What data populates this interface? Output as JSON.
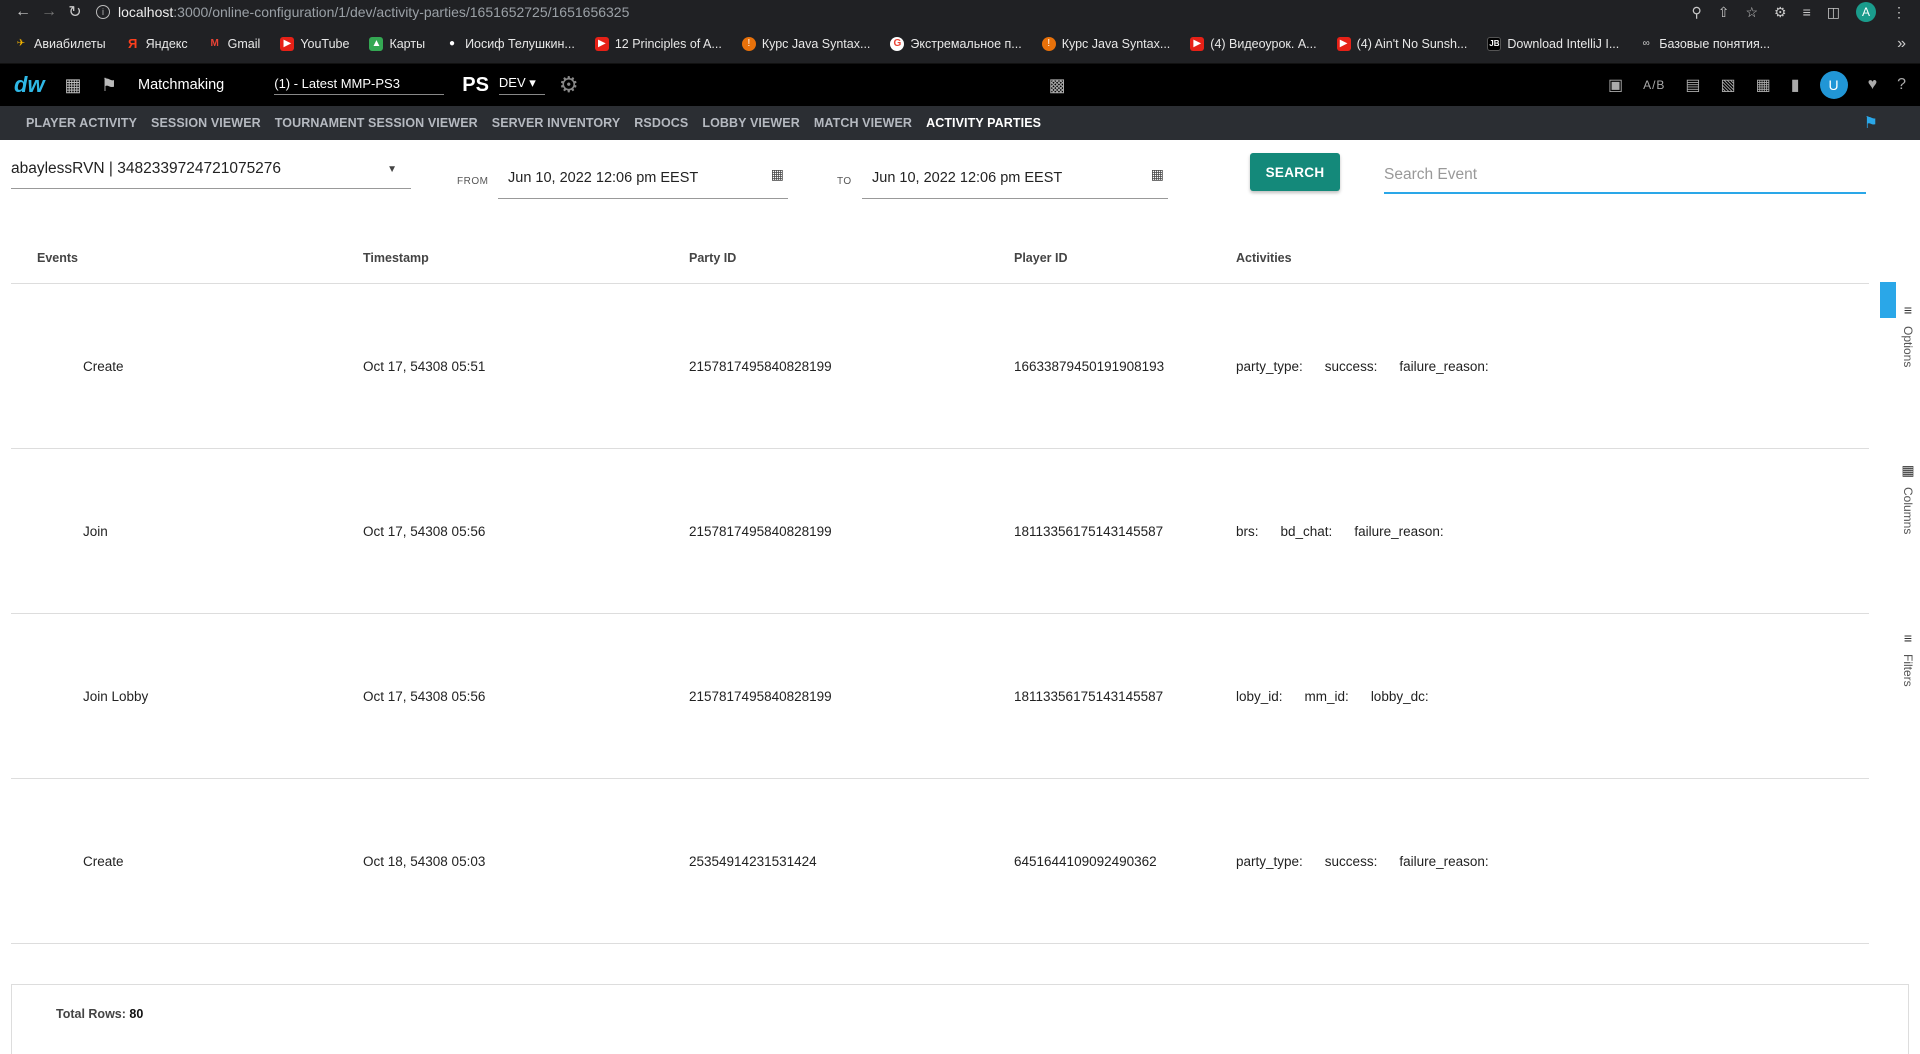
{
  "browser": {
    "url_host": "localhost",
    "url_path": ":3000/online-configuration/1/dev/activity-parties/1651652725/1651656325",
    "profile_initial": "A"
  },
  "bookmarks": [
    {
      "label": "Авиабилеты",
      "icon": "plane-icon"
    },
    {
      "label": "Яндекс",
      "icon": "yandex-icon"
    },
    {
      "label": "Gmail",
      "icon": "gmail-icon"
    },
    {
      "label": "YouTube",
      "icon": "youtube-icon"
    },
    {
      "label": "Карты",
      "icon": "maps-icon"
    },
    {
      "label": "Иосиф Телушкин...",
      "icon": "apple-icon"
    },
    {
      "label": "12 Principles of A...",
      "icon": "youtube-icon"
    },
    {
      "label": "Курс Java Syntax...",
      "icon": "javarush-icon"
    },
    {
      "label": "Экстремальное п...",
      "icon": "google-icon"
    },
    {
      "label": "Курс Java Syntax...",
      "icon": "javarush-icon"
    },
    {
      "label": "(4) Видеоурок. A...",
      "icon": "youtube-icon"
    },
    {
      "label": "(4) Ain't No Sunsh...",
      "icon": "youtube-icon"
    },
    {
      "label": "Download IntelliJ I...",
      "icon": "jetbrains-icon"
    },
    {
      "label": "Базовые понятия...",
      "icon": "link-icon"
    }
  ],
  "header": {
    "logo": "dw",
    "app_name": "Matchmaking",
    "environment": "(1) - Latest MMP-PS3",
    "platform_logo": "PS",
    "stage": "DEV",
    "ab_label": "A/B",
    "user_initial": "U"
  },
  "tabs": [
    {
      "label": "PLAYER ACTIVITY",
      "active": false
    },
    {
      "label": "SESSION VIEWER",
      "active": false
    },
    {
      "label": "TOURNAMENT SESSION VIEWER",
      "active": false
    },
    {
      "label": "SERVER INVENTORY",
      "active": false
    },
    {
      "label": "RSDOCS",
      "active": false
    },
    {
      "label": "LOBBY VIEWER",
      "active": false
    },
    {
      "label": "MATCH VIEWER",
      "active": false
    },
    {
      "label": "ACTIVITY PARTIES",
      "active": true
    }
  ],
  "filters": {
    "player": "abaylessRVN | 3482339724721075276",
    "from_label": "FROM",
    "from_value": "Jun 10, 2022 12:06 pm EEST",
    "to_label": "TO",
    "to_value": "Jun 10, 2022 12:06 pm EEST",
    "search_button": "SEARCH",
    "search_placeholder": "Search Event"
  },
  "table": {
    "columns": [
      "Events",
      "Timestamp",
      "Party ID",
      "Player ID",
      "Activities"
    ],
    "rows": [
      {
        "event": "Create",
        "timestamp": "Oct 17, 54308 05:51",
        "party_id": "2157817495840828199",
        "player_id": "16633879450191908193",
        "activities": [
          "party_type:",
          "success:",
          "failure_reason:"
        ]
      },
      {
        "event": "Join",
        "timestamp": "Oct 17, 54308 05:56",
        "party_id": "2157817495840828199",
        "player_id": "18113356175143145587",
        "activities": [
          "brs:",
          "bd_chat:",
          "failure_reason:"
        ]
      },
      {
        "event": "Join Lobby",
        "timestamp": "Oct 17, 54308 05:56",
        "party_id": "2157817495840828199",
        "player_id": "18113356175143145587",
        "activities": [
          "loby_id:",
          "mm_id:",
          "lobby_dc:"
        ]
      },
      {
        "event": "Create",
        "timestamp": "Oct 18, 54308 05:03",
        "party_id": "25354914231531424",
        "player_id": "6451644109092490362",
        "activities": [
          "party_type:",
          "success:",
          "failure_reason:"
        ]
      }
    ]
  },
  "side_panel": {
    "options": "Options",
    "columns": "Columns",
    "filters": "Filters"
  },
  "footer": {
    "total_label": "Total Rows:",
    "total_value": "80"
  }
}
